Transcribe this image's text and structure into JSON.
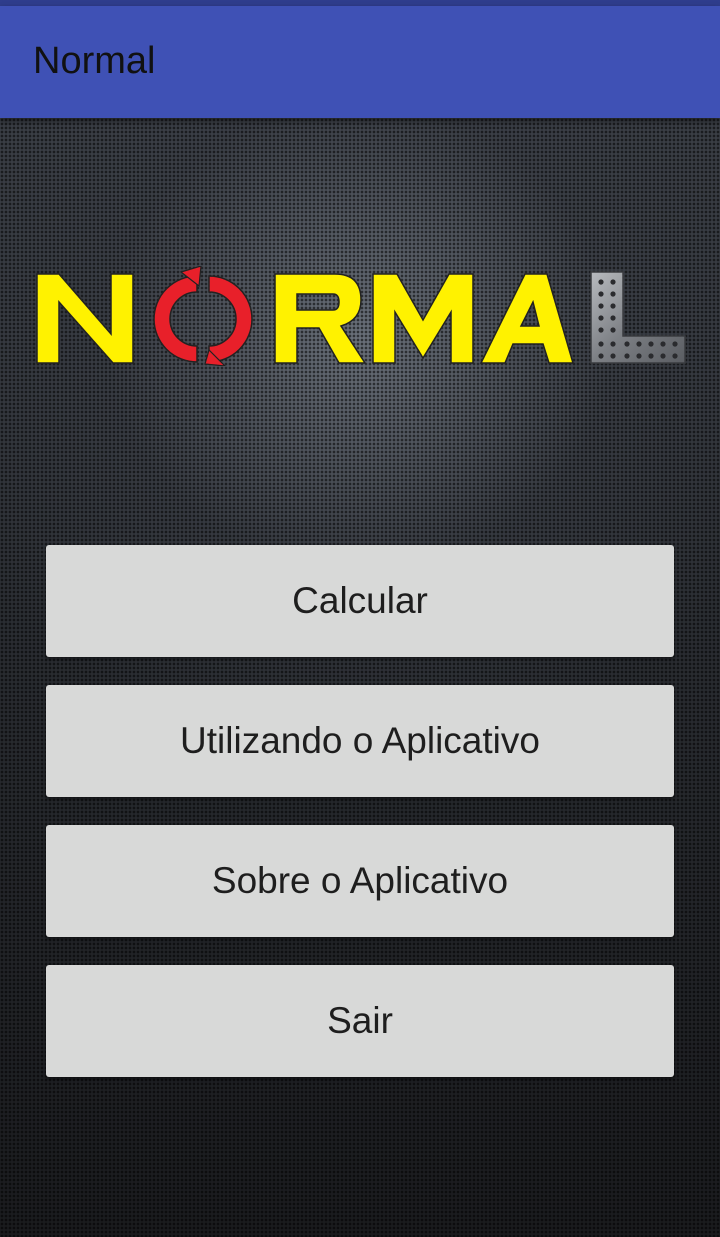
{
  "app_bar": {
    "title": "Normal",
    "color": "#3f51b5"
  },
  "logo": {
    "text": "NORMAL",
    "letter_color": "#fff200",
    "o_color": "#e8202a",
    "l_color": "#8a8d91"
  },
  "menu": {
    "buttons": [
      {
        "label": "Calcular"
      },
      {
        "label": "Utilizando o Aplicativo"
      },
      {
        "label": "Sobre o Aplicativo"
      },
      {
        "label": "Sair"
      }
    ],
    "button_color": "#d8d9d8"
  }
}
